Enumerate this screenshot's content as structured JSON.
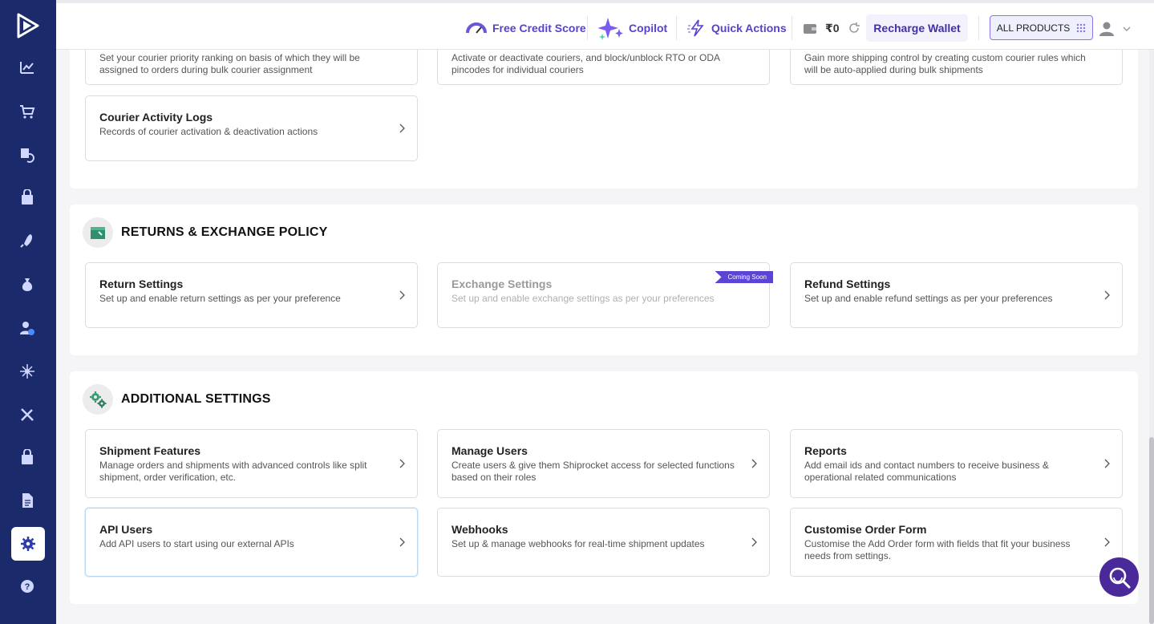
{
  "header": {
    "free_credit_score": "Free Credit Score",
    "copilot": "Copilot",
    "quick_actions": "Quick Actions",
    "wallet_balance": "₹0",
    "recharge_wallet": "Recharge Wallet",
    "all_products": "ALL PRODUCTS"
  },
  "courier_section": {
    "top_cards": [
      {
        "desc": "Set your courier priority ranking on basis of which they will be assigned to orders during bulk courier assignment"
      },
      {
        "desc": "Activate or deactivate couriers, and block/unblock RTO or ODA pincodes for individual couriers"
      },
      {
        "desc": "Gain more shipping control by creating custom courier rules which will be auto-applied during bulk shipments"
      }
    ],
    "activity_logs": {
      "title": "Courier Activity Logs",
      "desc": "Records of courier activation & deactivation actions"
    }
  },
  "returns_section": {
    "title": "RETURNS & EXCHANGE POLICY",
    "cards": [
      {
        "title": "Return Settings",
        "desc": "Set up and enable return settings as per your preference"
      },
      {
        "title": "Exchange Settings",
        "desc": "Set up and enable exchange settings as per your preferences",
        "badge": "Coming Soon"
      },
      {
        "title": "Refund Settings",
        "desc": "Set up and enable refund settings as per your preferences"
      }
    ]
  },
  "additional_section": {
    "title": "ADDITIONAL SETTINGS",
    "cards": [
      {
        "title": "Shipment Features",
        "desc": "Manage orders and shipments with advanced controls like split shipment, order verification, etc."
      },
      {
        "title": "Manage Users",
        "desc": "Create users & give them Shiprocket access for selected functions based on their roles"
      },
      {
        "title": "Reports",
        "desc": "Add email ids and contact numbers to receive business & operational related communications"
      },
      {
        "title": "API Users",
        "desc": "Add API users to start using our external APIs"
      },
      {
        "title": "Webhooks",
        "desc": "Set up & manage webhooks for real-time shipment updates"
      },
      {
        "title": "Customise Order Form",
        "desc": "Customise the Add Order form with fields that fit your business needs from settings."
      }
    ]
  },
  "colors": {
    "sidebar": "#1b2a6b",
    "accent": "#5a3fd0",
    "badge": "#5b44d6"
  },
  "icons": {
    "sidebar": [
      "dashboard-chart-icon",
      "cart-icon",
      "returns-icon",
      "lock-bag-icon",
      "rocket-icon",
      "money-bag-icon",
      "user-check-icon",
      "network-icon",
      "tools-icon",
      "lock-bag-icon",
      "document-icon",
      "gear-icon",
      "help-icon"
    ]
  }
}
